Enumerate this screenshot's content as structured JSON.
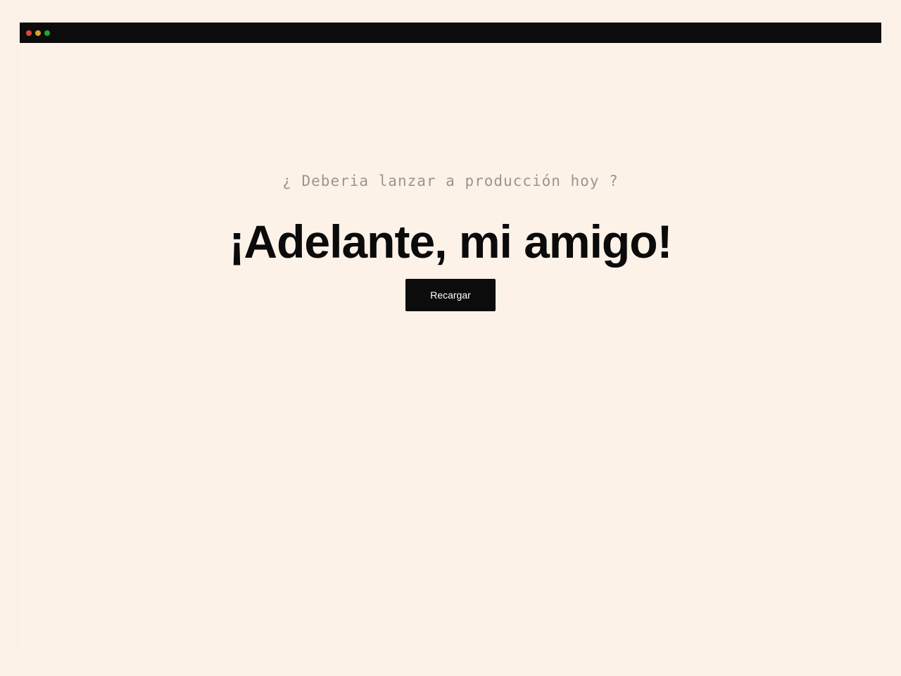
{
  "window": {
    "controls": [
      {
        "name": "close-dot",
        "color": "#e0443e"
      },
      {
        "name": "minimize-dot",
        "color": "#dea123"
      },
      {
        "name": "maximize-dot",
        "color": "#1aab29"
      }
    ]
  },
  "main": {
    "question": "¿ Deberia lanzar a producción hoy ?",
    "answer": "¡Adelante, mi amigo!",
    "reload_label": "Recargar"
  },
  "colors": {
    "background": "#fdf2e8",
    "titlebar": "#0c0c0c",
    "question_text": "#9a958f",
    "answer_text": "#0b0b0b",
    "button_bg": "#0c0c0c",
    "button_text": "#ffffff"
  }
}
